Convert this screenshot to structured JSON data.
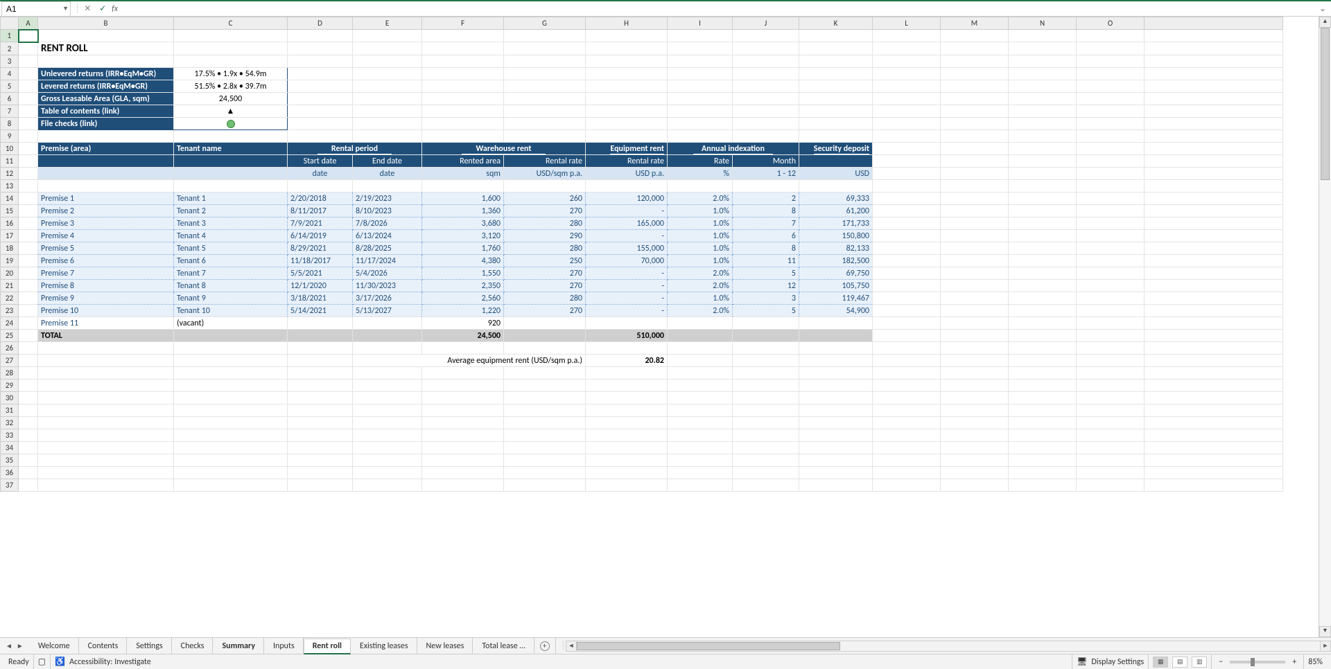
{
  "nameBox": "A1",
  "fxLabel": "fx",
  "title": "RENT ROLL",
  "kpi": {
    "rows": [
      {
        "label": "Unlevered returns (IRR•EqM•GR)",
        "value": "17.5% • 1.9x • 54.9m"
      },
      {
        "label": "Levered returns (IRR•EqM•GR)",
        "value": "51.5% • 2.8x • 39.7m"
      },
      {
        "label": "Gross Leasable Area (GLA, sqm)",
        "value": "24,500"
      },
      {
        "label": "Table of contents (link)",
        "value": "▲"
      },
      {
        "label": "File checks (link)",
        "value": "●"
      }
    ]
  },
  "columns": [
    "A",
    "B",
    "C",
    "D",
    "E",
    "F",
    "G",
    "H",
    "I",
    "J",
    "K",
    "L",
    "M",
    "N",
    "O"
  ],
  "rowNums": [
    1,
    2,
    3,
    4,
    5,
    6,
    7,
    8,
    9,
    10,
    11,
    12,
    13,
    14,
    15,
    16,
    17,
    18,
    19,
    20,
    21,
    22,
    23,
    24,
    25,
    26,
    27,
    28,
    29,
    30,
    31,
    32,
    33,
    34,
    35,
    36,
    37
  ],
  "header": {
    "premise": "Premise (area)",
    "tenant": "Tenant name",
    "rental_period": "Rental period",
    "warehouse": "Warehouse rent",
    "equipment": "Equipment rent",
    "indexation": "Annual indexation",
    "security": "Security deposit",
    "start": "Start date",
    "end": "End date",
    "area": "Rented area",
    "wh_rate": "Rental rate",
    "eq_rate": "Rental rate",
    "idx_rate": "Rate",
    "idx_month": "Month"
  },
  "units": {
    "start": "date",
    "end": "date",
    "area": "sqm",
    "wh_rate": "USD/sqm p.a.",
    "eq_rate": "USD p.a.",
    "idx_rate": "%",
    "idx_month": "1 - 12",
    "sec": "USD"
  },
  "rows": [
    {
      "p": "Premise 1",
      "t": "Tenant 1",
      "sd": "2/20/2018",
      "ed": "2/19/2023",
      "area": "1,600",
      "wr": "260",
      "er": "120,000",
      "ir": "2.0%",
      "im": "2",
      "sec": "69,333"
    },
    {
      "p": "Premise 2",
      "t": "Tenant 2",
      "sd": "8/11/2017",
      "ed": "8/10/2023",
      "area": "1,360",
      "wr": "270",
      "er": "-",
      "ir": "1.0%",
      "im": "8",
      "sec": "61,200"
    },
    {
      "p": "Premise 3",
      "t": "Tenant 3",
      "sd": "7/9/2021",
      "ed": "7/8/2026",
      "area": "3,680",
      "wr": "280",
      "er": "165,000",
      "ir": "1.0%",
      "im": "7",
      "sec": "171,733"
    },
    {
      "p": "Premise 4",
      "t": "Tenant 4",
      "sd": "6/14/2019",
      "ed": "6/13/2024",
      "area": "3,120",
      "wr": "290",
      "er": "-",
      "ir": "1.0%",
      "im": "6",
      "sec": "150,800"
    },
    {
      "p": "Premise 5",
      "t": "Tenant 5",
      "sd": "8/29/2021",
      "ed": "8/28/2025",
      "area": "1,760",
      "wr": "280",
      "er": "155,000",
      "ir": "1.0%",
      "im": "8",
      "sec": "82,133"
    },
    {
      "p": "Premise 6",
      "t": "Tenant 6",
      "sd": "11/18/2017",
      "ed": "11/17/2024",
      "area": "4,380",
      "wr": "250",
      "er": "70,000",
      "ir": "1.0%",
      "im": "11",
      "sec": "182,500"
    },
    {
      "p": "Premise 7",
      "t": "Tenant 7",
      "sd": "5/5/2021",
      "ed": "5/4/2026",
      "area": "1,550",
      "wr": "270",
      "er": "-",
      "ir": "2.0%",
      "im": "5",
      "sec": "69,750"
    },
    {
      "p": "Premise 8",
      "t": "Tenant 8",
      "sd": "12/1/2020",
      "ed": "11/30/2023",
      "area": "2,350",
      "wr": "270",
      "er": "-",
      "ir": "2.0%",
      "im": "12",
      "sec": "105,750"
    },
    {
      "p": "Premise 9",
      "t": "Tenant 9",
      "sd": "3/18/2021",
      "ed": "3/17/2026",
      "area": "2,560",
      "wr": "280",
      "er": "-",
      "ir": "1.0%",
      "im": "3",
      "sec": "119,467"
    },
    {
      "p": "Premise 10",
      "t": "Tenant 10",
      "sd": "5/14/2021",
      "ed": "5/13/2027",
      "area": "1,220",
      "wr": "270",
      "er": "-",
      "ir": "2.0%",
      "im": "5",
      "sec": "54,900"
    }
  ],
  "vacant": {
    "p": "Premise 11",
    "t": "(vacant)",
    "area": "920"
  },
  "total": {
    "label": "TOTAL",
    "area": "24,500",
    "er": "510,000"
  },
  "avg": {
    "label": "Average equipment rent (USD/sqm p.a.)",
    "value": "20.82"
  },
  "tabs": [
    "Welcome",
    "Contents",
    "Settings",
    "Checks",
    "Summary",
    "Inputs",
    "Rent roll",
    "Existing leases",
    "New leases",
    "Total lease …"
  ],
  "activeTab": 6,
  "boldTabs": [
    4
  ],
  "status": {
    "ready": "Ready",
    "accessibility": "Accessibility: Investigate",
    "display": "Display Settings",
    "zoom": "85%"
  }
}
